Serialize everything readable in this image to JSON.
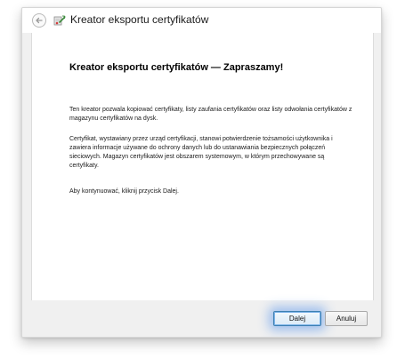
{
  "window": {
    "title": "Kreator eksportu certyfikatów"
  },
  "content": {
    "heading": "Kreator eksportu certyfikatów — Zapraszamy!",
    "paragraph1": "Ten kreator pozwala kopiować certyfikaty, listy zaufania certyfikatów oraz listy odwołania certyfikatów z magazynu certyfikatów na dysk.",
    "paragraph2": "Certyfikat, wystawiany przez urząd certyfikacji, stanowi potwierdzenie tożsamości użytkownika i zawiera informacje używane do ochrony danych lub do ustanawiania bezpiecznych połączeń sieciowych. Magazyn certyfikatów jest obszarem systemowym, w którym przechowywane są certyfikaty.",
    "paragraph3": "Aby kontynuować, kliknij przycisk Dalej."
  },
  "buttons": {
    "next_label": "Dalej",
    "cancel_label": "Anuluj"
  },
  "icons": {
    "back": "back-arrow-icon",
    "wizard": "certificate-wizard-icon"
  },
  "colors": {
    "focus_glow": "#3c82eb",
    "dialog_background": "#f0f0f0"
  }
}
